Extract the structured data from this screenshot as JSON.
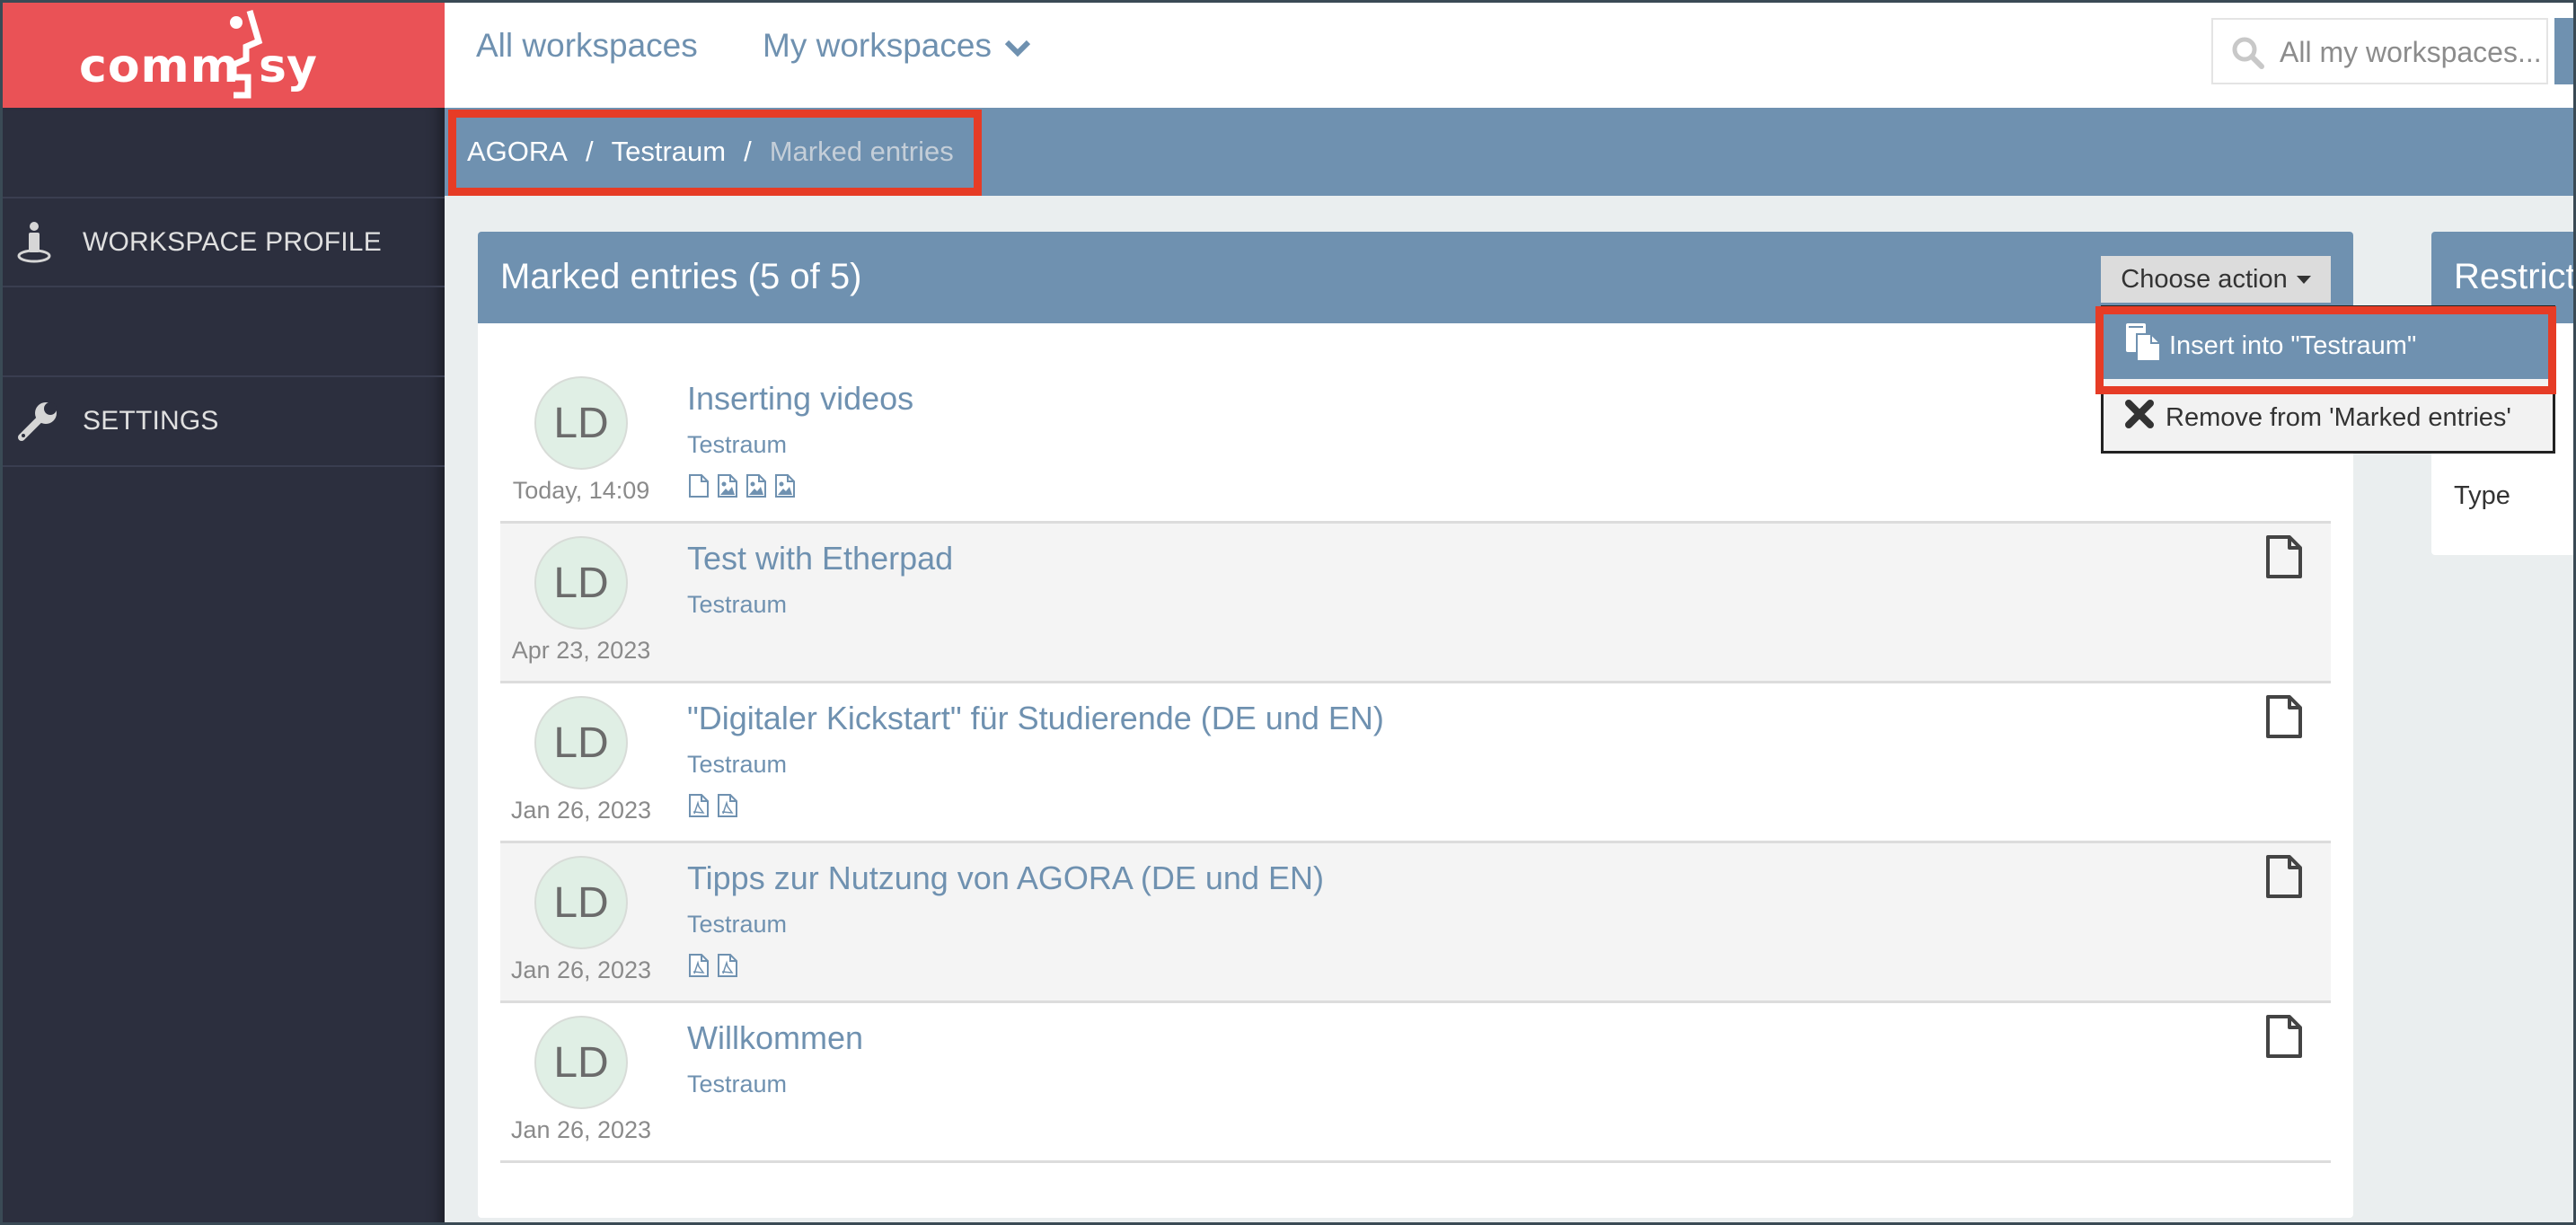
{
  "brand": {
    "logo_text": "commsy",
    "logo_color": "#ea5256"
  },
  "topnav": {
    "all_workspaces": "All workspaces",
    "my_workspaces": "My workspaces",
    "search_placeholder": "All my workspaces..."
  },
  "breadcrumb": {
    "items": [
      "AGORA",
      "Testraum",
      "Marked entries"
    ],
    "separator": "/"
  },
  "sidebar": {
    "items": [
      {
        "label": "WORKSPACE PROFILE",
        "icon": "person-location-icon"
      },
      {
        "label": "SETTINGS",
        "icon": "wrench-icon"
      }
    ]
  },
  "card": {
    "title": "Marked entries (5 of 5)",
    "action_button": "Choose action"
  },
  "dropdown": {
    "items": [
      {
        "label": "Insert into \"Testraum\"",
        "icon": "copy-icon",
        "highlighted": true
      },
      {
        "label": "Remove from 'Marked entries'",
        "icon": "close-icon",
        "highlighted": false
      }
    ]
  },
  "entries": [
    {
      "initials": "LD",
      "date": "Today, 14:09",
      "title": "Inserting videos",
      "room": "Testraum",
      "files": [
        "file-icon",
        "image-file-icon",
        "image-file-icon",
        "image-file-icon"
      ],
      "type_icon": ""
    },
    {
      "initials": "LD",
      "date": "Apr 23, 2023",
      "title": "Test with Etherpad",
      "room": "Testraum",
      "files": [],
      "type_icon": "document-icon"
    },
    {
      "initials": "LD",
      "date": "Jan 26, 2023",
      "title": "\"Digitaler Kickstart\" für Studierende (DE und EN)",
      "room": "Testraum",
      "files": [
        "pdf-file-icon",
        "pdf-file-icon"
      ],
      "type_icon": "document-icon"
    },
    {
      "initials": "LD",
      "date": "Jan 26, 2023",
      "title": "Tipps zur Nutzung von AGORA (DE und EN)",
      "room": "Testraum",
      "files": [
        "pdf-file-icon",
        "pdf-file-icon"
      ],
      "type_icon": "document-icon"
    },
    {
      "initials": "LD",
      "date": "Jan 26, 2023",
      "title": "Willkommen",
      "room": "Testraum",
      "files": [],
      "type_icon": "document-icon"
    }
  ],
  "right_panel": {
    "title": "Restrict",
    "type_label": "Type"
  },
  "colors": {
    "primary": "#6f91b0",
    "sidebar": "#2c2f3e",
    "highlight": "#e63c26"
  }
}
